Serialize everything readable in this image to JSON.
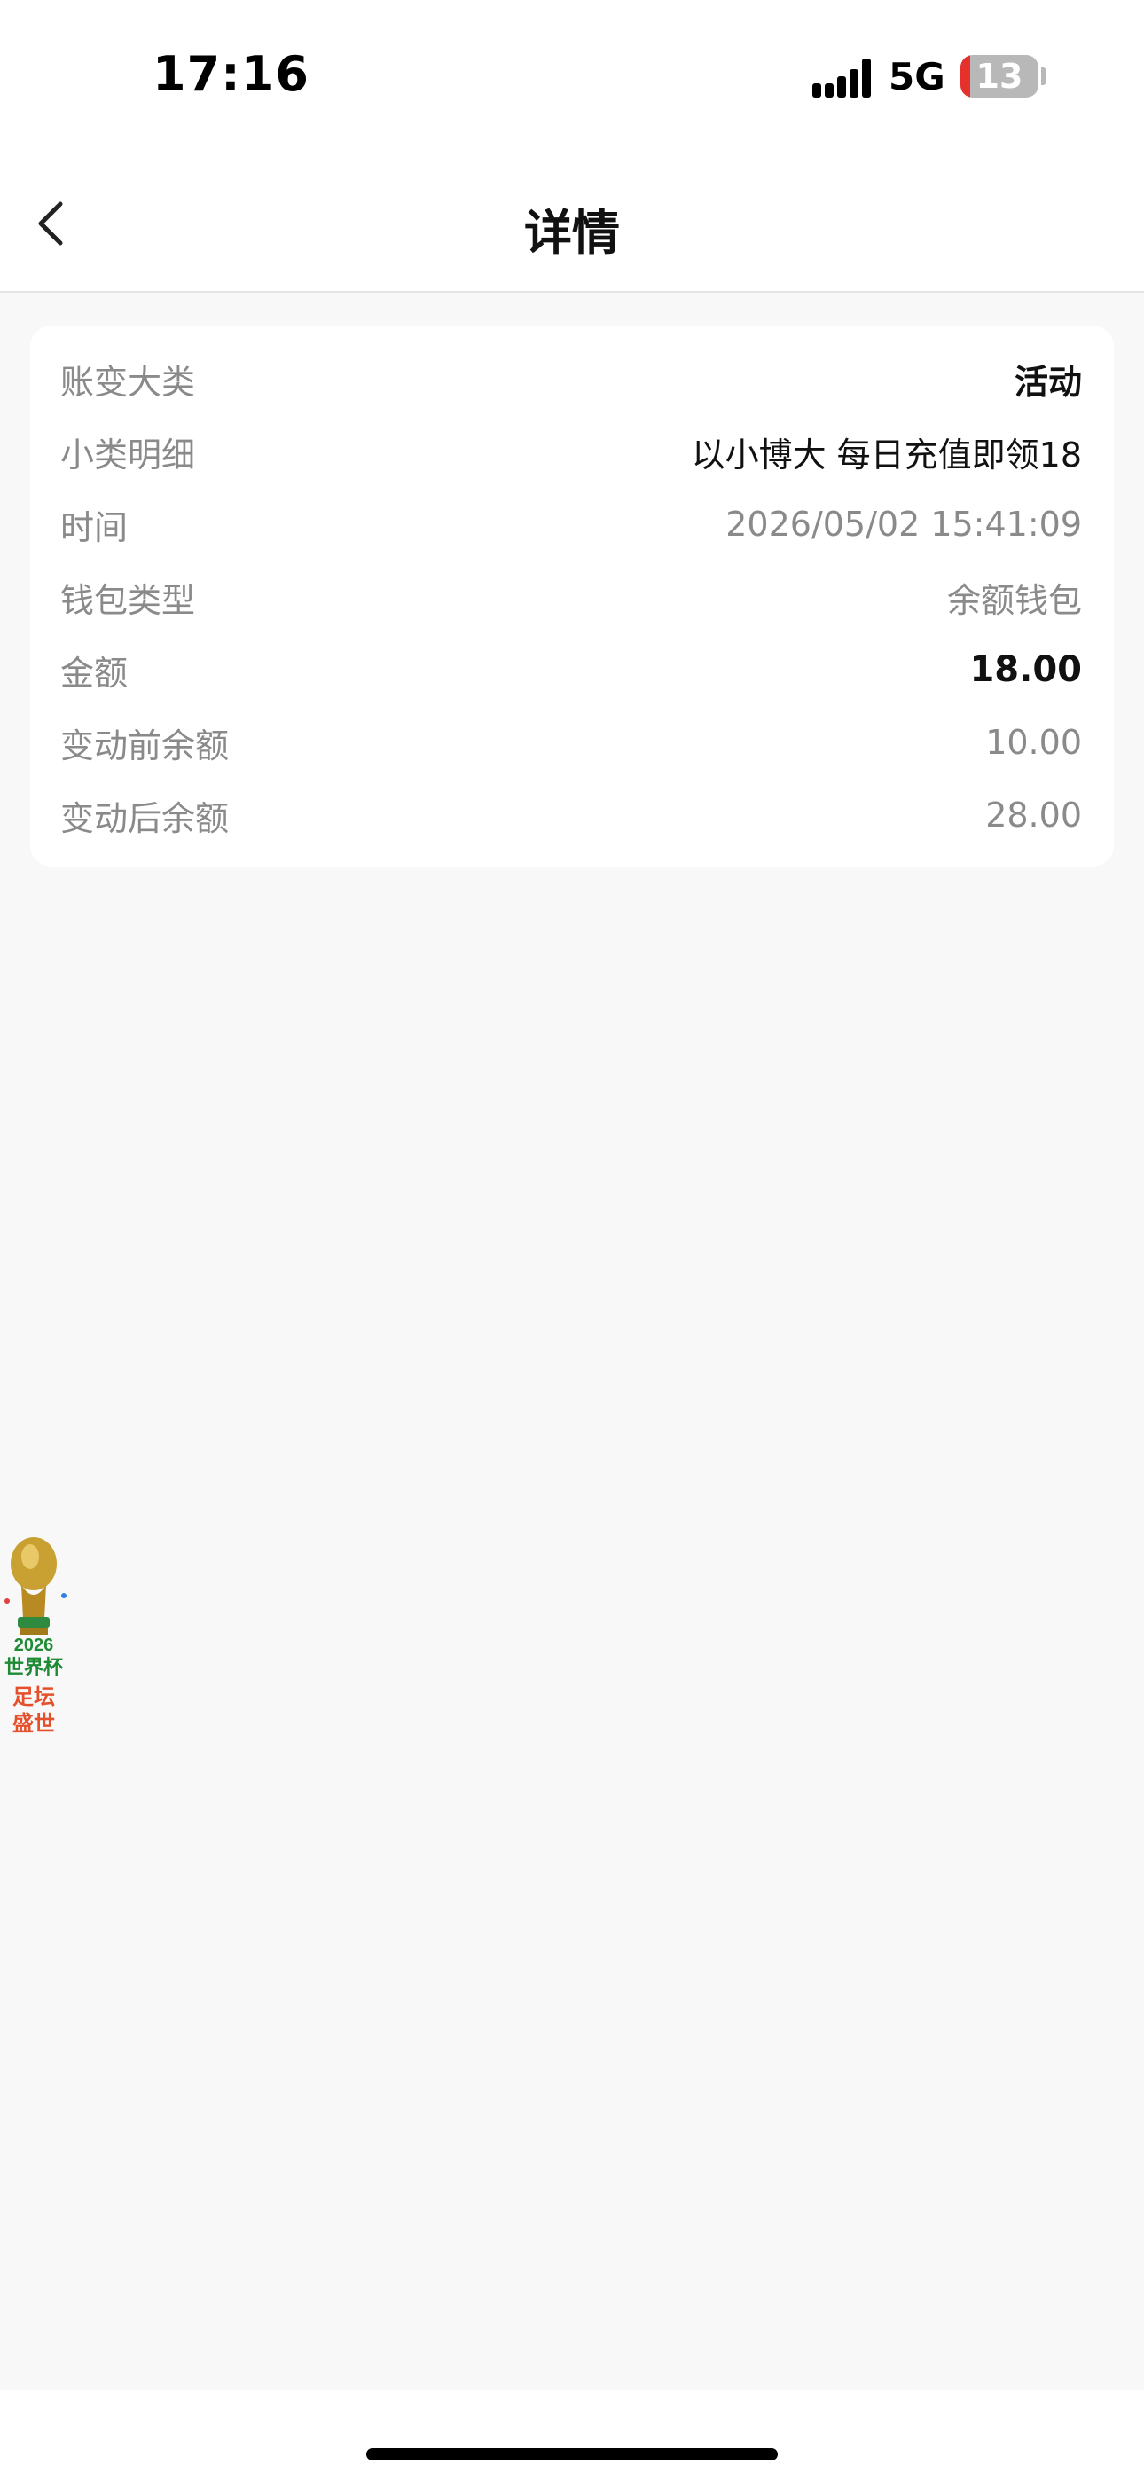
{
  "status_bar": {
    "time": "17:16",
    "network": "5G",
    "battery": "13",
    "battery_level_percent": 13,
    "battery_color": "#e5302c"
  },
  "nav": {
    "back_icon": "chevron-left-icon",
    "title": "详情"
  },
  "details": [
    {
      "label": "账变大类",
      "value": "活动"
    },
    {
      "label": "小类明细",
      "value": "以小博大 每日充值即领18"
    },
    {
      "label": "时间",
      "value": "2026/05/02 15:41:09"
    },
    {
      "label": "钱包类型",
      "value": "余额钱包"
    },
    {
      "label": "金额",
      "value": "18.00"
    },
    {
      "label": "变动前余额",
      "value": "10.00"
    },
    {
      "label": "变动后余额",
      "value": "28.00"
    }
  ],
  "badge": {
    "icon": "world-cup-trophy-icon",
    "year": "2026",
    "line1": "世界杯",
    "line2": "足坛",
    "line3": "盛世"
  }
}
